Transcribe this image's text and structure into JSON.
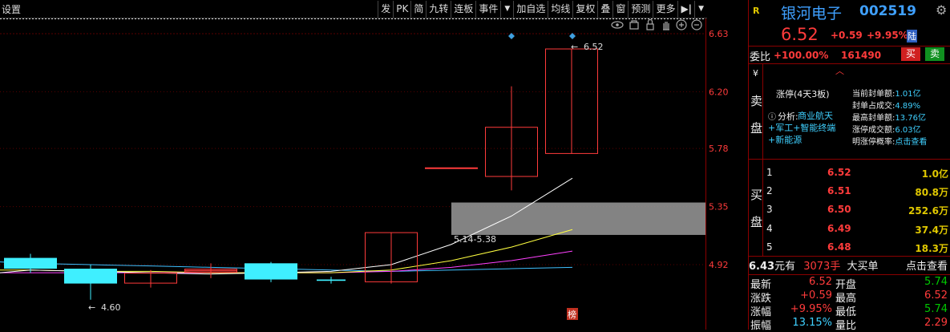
{
  "toolbar": {
    "settings": "设置",
    "buttons": [
      "发",
      "PK",
      "简",
      "九转",
      "连板",
      "事件",
      "加自选",
      "均线",
      "复权",
      "叠",
      "窗",
      "预测",
      "更多"
    ],
    "dropdown_arrow": "▼",
    "panel_toggle": "▶|"
  },
  "chart": {
    "price_labels": [
      "6.63",
      "6.20",
      "5.78",
      "5.35",
      "4.92"
    ],
    "last_price_tag": "6.52",
    "low_price_tag": "4.60",
    "range_label": "5.14-5.38",
    "list_badge": "榜",
    "colors": {
      "up": "#ff3b3b",
      "down": "#3fefff",
      "ma5": "#ffffff",
      "ma10": "#ffff40",
      "ma20": "#ff40ff",
      "ma60": "#40c0ff",
      "zone": "#9a9a9a"
    },
    "candles": [
      {
        "open": 4.89,
        "close": 4.97,
        "high": 5.0,
        "low": 4.86,
        "kind": "down"
      },
      {
        "open": 4.78,
        "close": 4.89,
        "high": 4.92,
        "low": 4.66,
        "kind": "down"
      },
      {
        "open": 4.78,
        "close": 4.86,
        "high": 4.88,
        "low": 4.75,
        "kind": "up"
      },
      {
        "open": 4.86,
        "close": 4.88,
        "high": 4.9,
        "low": 4.82,
        "kind": "up"
      },
      {
        "open": 4.87,
        "close": 4.89,
        "high": 4.93,
        "low": 4.84,
        "kind": "up"
      },
      {
        "open": 4.81,
        "close": 4.93,
        "high": 4.94,
        "low": 4.79,
        "kind": "down"
      },
      {
        "open": 4.8,
        "close": 4.81,
        "high": 4.83,
        "low": 4.78,
        "kind": "down"
      },
      {
        "open": 4.79,
        "close": 5.16,
        "high": 5.16,
        "low": 4.78,
        "kind": "up"
      },
      {
        "open": 5.64,
        "close": 5.64,
        "high": 5.64,
        "low": 5.64,
        "kind": "up"
      },
      {
        "open": 5.57,
        "close": 5.94,
        "high": 6.24,
        "low": 5.47,
        "kind": "up"
      },
      {
        "open": 5.74,
        "close": 6.52,
        "high": 6.52,
        "low": 5.74,
        "kind": "up"
      }
    ],
    "ma5": [
      4.86,
      4.88,
      4.87,
      4.86,
      4.85,
      4.86,
      4.87,
      4.92,
      5.07,
      5.28,
      5.56
    ],
    "ma10": [
      4.88,
      4.88,
      4.87,
      4.87,
      4.86,
      4.86,
      4.86,
      4.88,
      4.95,
      5.05,
      5.18
    ],
    "ma20": [
      4.86,
      4.86,
      4.86,
      4.86,
      4.86,
      4.86,
      4.86,
      4.87,
      4.9,
      4.95,
      5.02
    ],
    "ma60": [
      4.94,
      4.93,
      4.92,
      4.91,
      4.9,
      4.89,
      4.88,
      4.87,
      4.88,
      4.89,
      4.9
    ]
  },
  "header": {
    "market_badge": "R",
    "stock_name": "银河电子",
    "stock_code": "002519",
    "price": "6.52",
    "change": "+0.59",
    "pct": "+9.95%",
    "exchange": "陆",
    "ratio_label": "委比",
    "ratio_value": "+100.00%",
    "ratio_diff": "161490",
    "buy_btn": "买",
    "sell_btn": "卖"
  },
  "sell_side": {
    "yen": "¥",
    "label_top": "卖",
    "label_bottom": "盘",
    "limit_up_title": "涨停(4天3板)",
    "analysis_label": "分析:",
    "analysis_text": "商业航天+军工+智能终端+新能源",
    "stats": [
      {
        "label": "当前封单额:",
        "value": "1.01亿"
      },
      {
        "label": "封单占成交:",
        "value": "4.89%"
      },
      {
        "label": "最高封单额:",
        "value": "13.76亿"
      },
      {
        "label": "涨停成交额:",
        "value": "6.03亿"
      },
      {
        "label": "明涨停概率:",
        "value": "点击查看"
      }
    ]
  },
  "buy_side": {
    "label_top": "买",
    "label_bottom": "盘",
    "levels": [
      {
        "n": "1",
        "price": "6.52",
        "vol": "1.0亿"
      },
      {
        "n": "2",
        "price": "6.51",
        "vol": "80.8万"
      },
      {
        "n": "3",
        "price": "6.50",
        "vol": "252.6万"
      },
      {
        "n": "4",
        "price": "6.49",
        "vol": "37.4万"
      },
      {
        "n": "5",
        "price": "6.48",
        "vol": "18.3万"
      }
    ]
  },
  "big_order": {
    "price": "6.43",
    "unit": "元有",
    "hands": "3073手",
    "type": "大买单",
    "link": "点击查看"
  },
  "quote": [
    {
      "l1": "最新",
      "v1": "6.52",
      "l2": "开盘",
      "v2": "5.74"
    },
    {
      "l1": "涨跌",
      "v1": "+0.59",
      "l2": "最高",
      "v2": "6.52"
    },
    {
      "l1": "涨幅",
      "v1": "+9.95%",
      "l2": "最低",
      "v2": "5.74"
    },
    {
      "l1": "振幅",
      "v1": "13.15%",
      "l2": "量比",
      "v2": "2.29"
    }
  ]
}
